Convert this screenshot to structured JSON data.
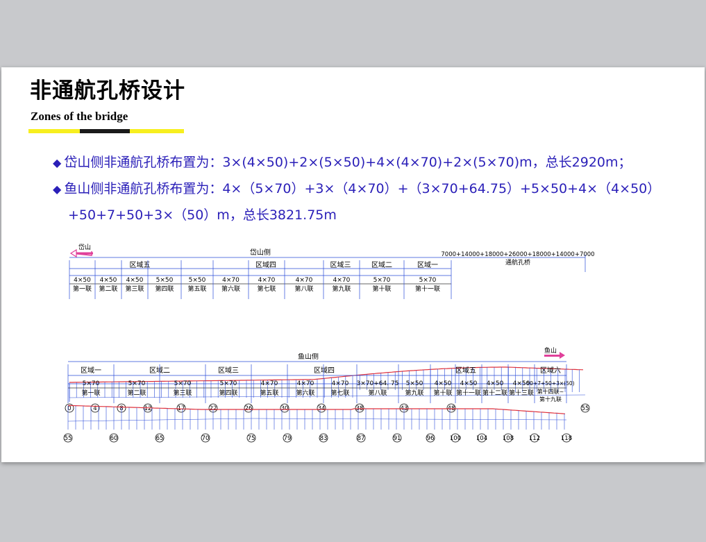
{
  "slide": {
    "title": "非通航孔桥设计",
    "subtitle": "Zones of the bridge",
    "bullet_marker": "◆",
    "bullet1": "岱山侧非通航孔桥布置为：3×(4×50)+2×(5×50)+4×(4×70)+2×(5×70)m，总长2920m；",
    "bullet2_line1": "鱼山侧非通航孔桥布置为：4×（5×70）+3×（4×70）+（3×70+64.75）+5×50+4×（4×50）",
    "bullet2_line2": "+50+7+50+3×（50）m，总长3821.75m",
    "accent_colors": {
      "title_bar_yellow": "#f7ef1f",
      "title_bar_black": "#1a1a1a",
      "bullet_text": "#2a1fb8",
      "profile_red": "#e0303a",
      "pier_blue": "#2a4bd8",
      "arrow_pink": "#e0409a"
    }
  },
  "diagram_top": {
    "side_arrow_label": "岱山",
    "side_title": "岱山侧",
    "nav_span_formula": "7000+14000+18000+26000+18000+14000+7000",
    "nav_span_name": "通航孔桥",
    "zones": [
      "区域五",
      "区域四",
      "区域三",
      "区域二",
      "区域一"
    ],
    "spans": [
      "4×50",
      "4×50",
      "4×50",
      "5×50",
      "5×50",
      "4×70",
      "4×70",
      "4×70",
      "4×70",
      "5×70",
      "5×70"
    ],
    "units": [
      "第一联",
      "第二联",
      "第三联",
      "第四联",
      "第五联",
      "第六联",
      "第七联",
      "第八联",
      "第九联",
      "第十联",
      "第十一联"
    ],
    "pier_labels": [
      "0",
      "4",
      "8",
      "12",
      "17",
      "22",
      "26",
      "30",
      "34",
      "38",
      "43",
      "48",
      "55"
    ]
  },
  "diagram_bottom": {
    "side_arrow_label": "鱼山",
    "side_title": "鱼山侧",
    "zones": [
      "区域一",
      "区域二",
      "区域三",
      "区域四",
      "区域五",
      "区域六"
    ],
    "spans": [
      "5×70",
      "5×70",
      "5×70",
      "5×70",
      "4×70",
      "4×70",
      "4×70",
      "3×70+64. 75",
      "5×50",
      "4×50",
      "4×50",
      "4×50",
      "4×50",
      "50+7+50+3×(50)"
    ],
    "units": [
      "第一联",
      "第二联",
      "第三联",
      "第四联",
      "第五联",
      "第六联",
      "第七联",
      "第八联",
      "第九联",
      "第十联",
      "第十一联",
      "第十二联",
      "第十三联",
      "第十四联~",
      "第十九联"
    ],
    "pier_labels": [
      "55",
      "60",
      "65",
      "70",
      "75",
      "79",
      "83",
      "87",
      "91",
      "96",
      "100",
      "104",
      "108",
      "112",
      "118"
    ]
  }
}
